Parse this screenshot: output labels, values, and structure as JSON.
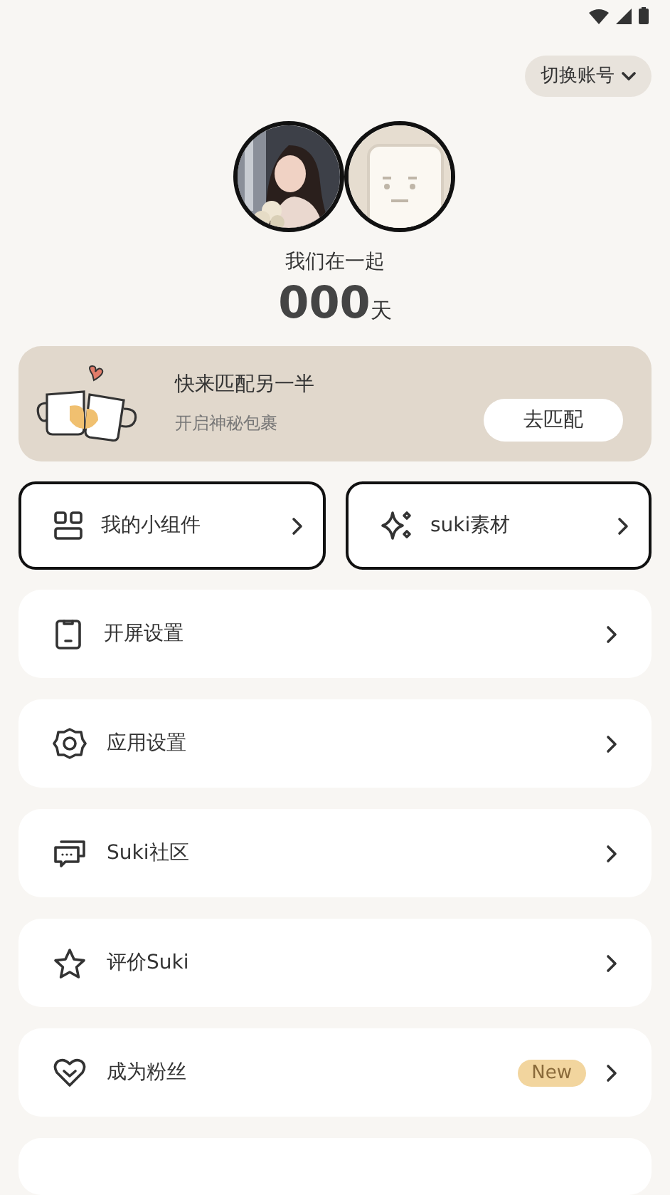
{
  "header": {
    "switch_account": "切换账号"
  },
  "couple": {
    "caption": "我们在一起",
    "days": "000",
    "days_unit": "天"
  },
  "match_card": {
    "title": "快来匹配另一半",
    "subtitle": "开启神秘包裹",
    "button": "去匹配"
  },
  "shortcuts": [
    {
      "label": "我的小组件"
    },
    {
      "label": "suki素材"
    }
  ],
  "menu": [
    {
      "label": "开屏设置"
    },
    {
      "label": "应用设置"
    },
    {
      "label": "Suki社区"
    },
    {
      "label": "评价Suki"
    },
    {
      "label": "成为粉丝",
      "badge": "New"
    }
  ]
}
